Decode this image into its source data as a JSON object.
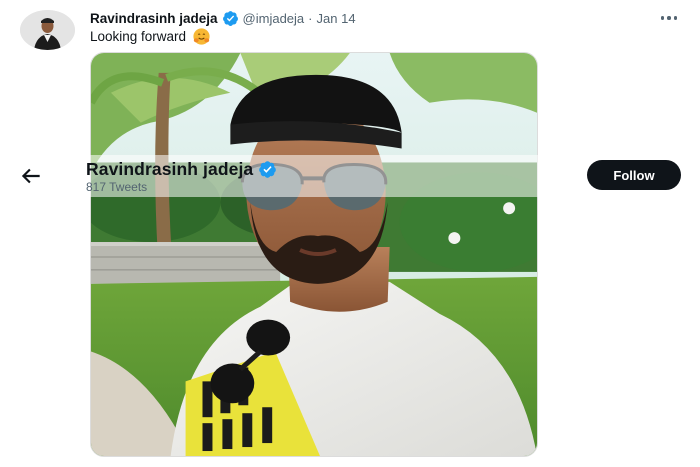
{
  "tweet": {
    "author_name": "Ravindrasinh jadeja",
    "handle": "@imjadeja",
    "separator": "·",
    "date": "Jan 14",
    "text": "Looking forward",
    "emoji": "hugging-face-emoji"
  },
  "profile_header": {
    "name": "Ravindrasinh jadeja",
    "tweets_count": "817 Tweets",
    "follow_label": "Follow"
  },
  "icons": {
    "verified": "verified-badge-icon",
    "back": "arrow-left-icon",
    "more": "more-horizontal-icon"
  },
  "colors": {
    "verified_blue": "#1d9bf0",
    "follow_button_bg": "#0f1419",
    "secondary_text": "#536471"
  }
}
